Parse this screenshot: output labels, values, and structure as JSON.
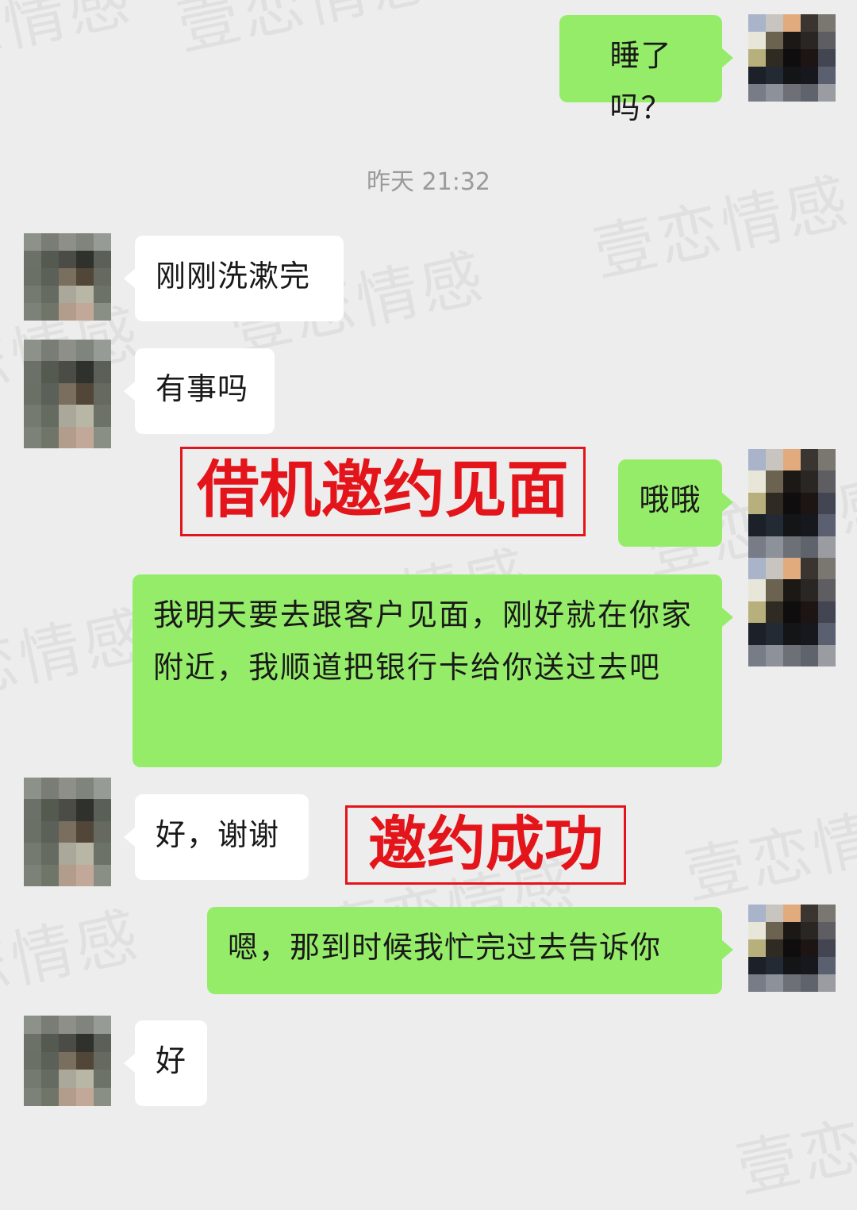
{
  "watermark_text": "壹恋情感",
  "timestamp": "昨天 21:32",
  "messages": [
    {
      "side": "right",
      "text": "睡了吗？"
    },
    {
      "side": "left",
      "text": "刚刚洗漱完"
    },
    {
      "side": "left",
      "text": "有事吗"
    },
    {
      "side": "right",
      "text": "哦哦"
    },
    {
      "side": "right",
      "text": "我明天要去跟客户见面，刚好就在你家附近，我顺道把银行卡给你送过去吧"
    },
    {
      "side": "left",
      "text": "好，谢谢"
    },
    {
      "side": "right",
      "text": "嗯，那到时候我忙完过去告诉你"
    },
    {
      "side": "left",
      "text": "好"
    }
  ],
  "annotations": {
    "invite_meeting": "借机邀约见面",
    "invite_success": "邀约成功"
  },
  "colors": {
    "background": "#ededed",
    "sent_bubble": "#95ec69",
    "received_bubble": "#ffffff",
    "annotation_red": "#e4141b"
  }
}
